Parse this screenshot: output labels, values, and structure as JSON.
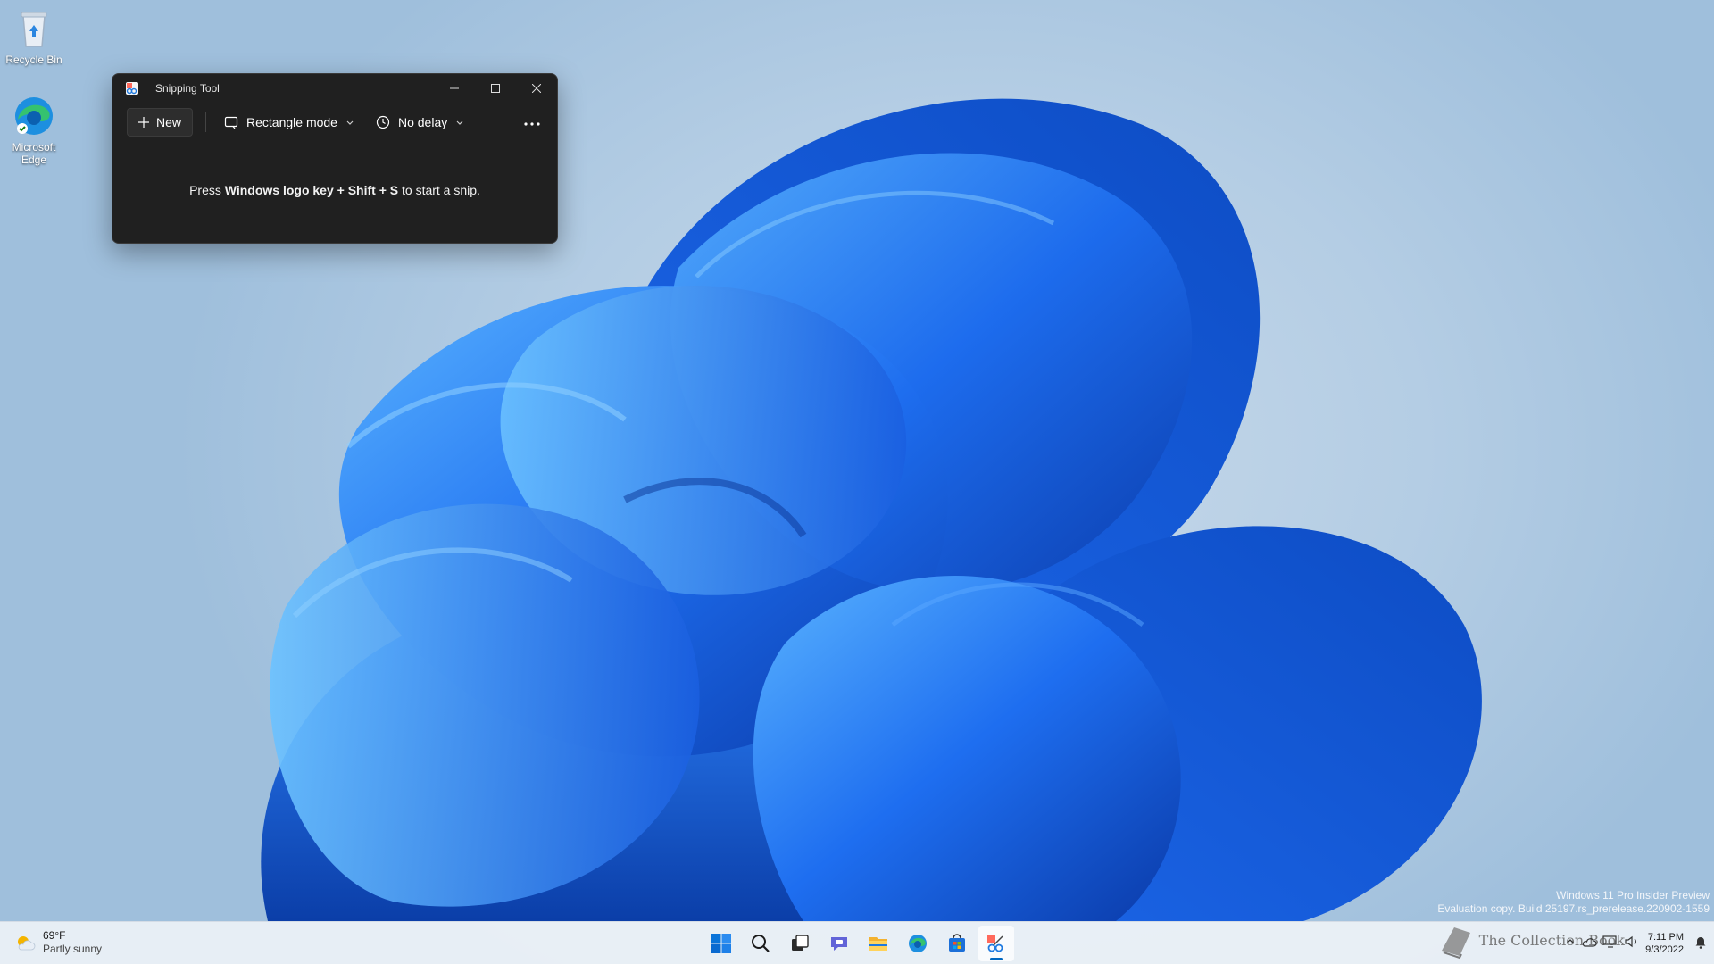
{
  "desktop": {
    "icons": [
      {
        "label": "Recycle Bin",
        "icon": "recycle-bin-icon"
      },
      {
        "label": "Microsoft Edge",
        "icon": "edge-icon"
      }
    ]
  },
  "snipping_tool": {
    "title": "Snipping Tool",
    "toolbar": {
      "new_label": "New",
      "mode_label": "Rectangle mode",
      "delay_label": "No delay"
    },
    "hint": {
      "prefix": "Press ",
      "keys": "Windows logo key + Shift + S",
      "suffix": " to start a snip."
    }
  },
  "watermark": {
    "line1": "Windows 11 Pro Insider Preview",
    "line2": "Evaluation copy. Build 25197.rs_prerelease.220902-1559"
  },
  "taskbar": {
    "weather": {
      "temp": "69°F",
      "condition": "Partly sunny"
    },
    "apps": [
      "start-icon",
      "search-icon",
      "task-view-icon",
      "teams-chat-icon",
      "file-explorer-icon",
      "edge-icon",
      "store-icon",
      "snipping-tool-icon"
    ],
    "clock": {
      "time": "7:11 PM",
      "date": "9/3/2022"
    },
    "logo_text": "The Collection Book"
  },
  "colors": {
    "accent": "#0067c0",
    "window_bg": "#202020",
    "bloom_dark": "#0a3fb0",
    "bloom_light": "#3aa0ff"
  }
}
